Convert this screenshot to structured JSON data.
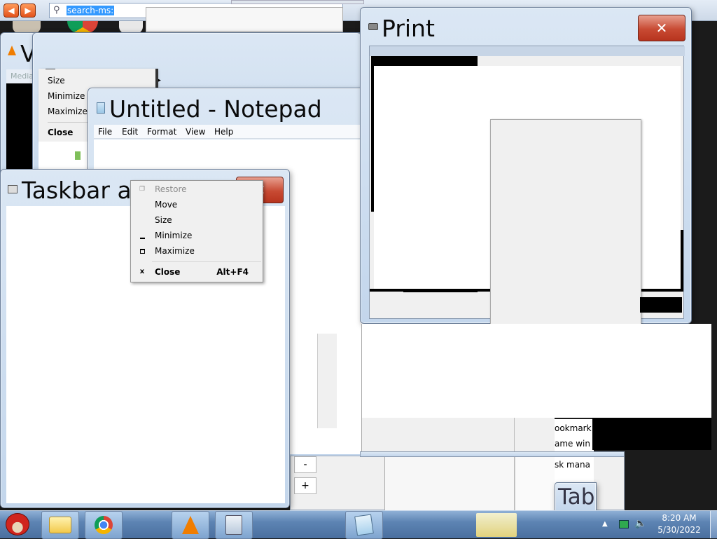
{
  "browser": {
    "address_value": "search-ms:"
  },
  "vlc_window": {
    "title": "V",
    "menu_fragment": "Media"
  },
  "vlc_system_menu": {
    "items": [
      {
        "label": "Size"
      },
      {
        "label": "Minimize"
      },
      {
        "label": "Maximize"
      },
      {
        "label": "Close"
      }
    ]
  },
  "notepad": {
    "title": "Untitled - Notepad",
    "menu": [
      "File",
      "Edit",
      "Format",
      "View",
      "Help"
    ]
  },
  "taskbar_window": {
    "title": "Taskbar ar",
    "system_menu": {
      "items": [
        {
          "label": "Restore",
          "disabled": true,
          "icon": "restore-icon"
        },
        {
          "label": "Move",
          "disabled": false
        },
        {
          "label": "Size",
          "disabled": false
        },
        {
          "label": "Minimize",
          "disabled": false,
          "icon": "minimize-icon"
        },
        {
          "label": "Maximize",
          "disabled": false,
          "icon": "maximize-icon"
        },
        {
          "label": "Close",
          "disabled": false,
          "icon": "close-icon",
          "accelerator": "Alt+F4",
          "bold": true
        }
      ]
    }
  },
  "print_window": {
    "title": "Print"
  },
  "background_window": {
    "list_items": [
      "ookmark",
      "ame win",
      "sk mana"
    ],
    "tab_title": "Tab",
    "zoom_minus": "-",
    "zoom_plus": "+"
  },
  "taskbar": {
    "apps": [
      {
        "name": "angry-birds-start",
        "icon": "angry-bird-icon"
      },
      {
        "name": "file-explorer",
        "icon": "folder-icon"
      },
      {
        "name": "chrome",
        "icon": "chrome-icon"
      },
      {
        "name": "vlc",
        "icon": "vlc-cone-icon"
      },
      {
        "name": "calculator",
        "icon": "calculator-icon"
      },
      {
        "name": "notepad",
        "icon": "notepad-icon"
      }
    ],
    "clock_time": "8:20 AM",
    "clock_date": "5/30/2022"
  },
  "colors": {
    "close_red": "#c84a33",
    "glass_blue": "#c3d6ec",
    "taskbar_blue": "#5d84b3"
  }
}
